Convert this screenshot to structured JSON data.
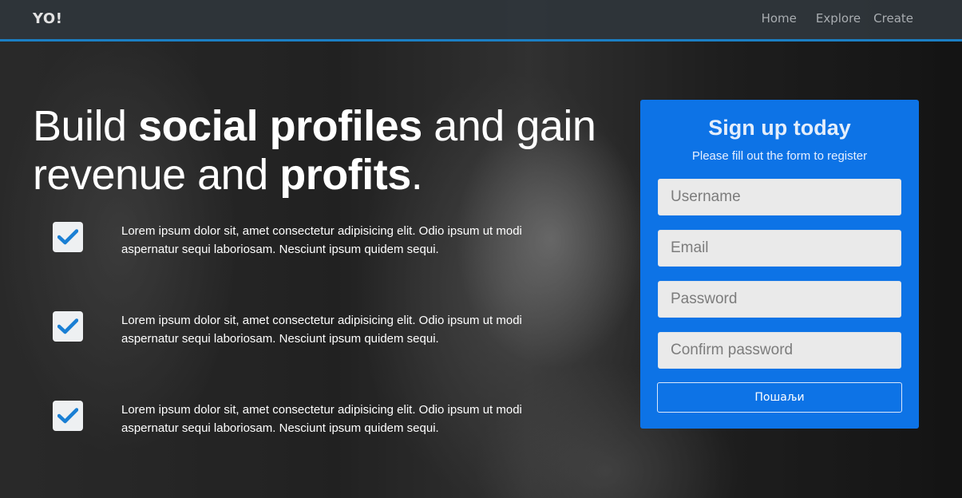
{
  "nav": {
    "brand": "YO!",
    "links": [
      "Home",
      "Explore",
      "Create"
    ]
  },
  "hero": {
    "line1_a": "Build ",
    "line1_b": "social profiles",
    "line1_c": " and gain",
    "line2_a": "revenue and ",
    "line2_b": "profits",
    "line2_c": "."
  },
  "features": [
    {
      "text": "Lorem ipsum dolor sit, amet consectetur adipisicing elit. Odio ipsum ut modi aspernatur sequi laboriosam. Nesciunt ipsum quidem sequi."
    },
    {
      "text": "Lorem ipsum dolor sit, amet consectetur adipisicing elit. Odio ipsum ut modi aspernatur sequi laboriosam. Nesciunt ipsum quidem sequi."
    },
    {
      "text": "Lorem ipsum dolor sit, amet consectetur adipisicing elit. Odio ipsum ut modi aspernatur sequi laboriosam. Nesciunt ipsum quidem sequi."
    }
  ],
  "signup": {
    "title": "Sign up today",
    "subtitle": "Please fill out the form to register",
    "username_placeholder": "Username",
    "email_placeholder": "Email",
    "password_placeholder": "Password",
    "confirm_placeholder": "Confirm password",
    "submit_label": "Пошаљи"
  },
  "colors": {
    "accent": "#0d73e6",
    "nav_border": "#1b7fc4",
    "check": "#1a7fd4"
  },
  "icons": {
    "feature": "checkbox-checked-icon"
  }
}
